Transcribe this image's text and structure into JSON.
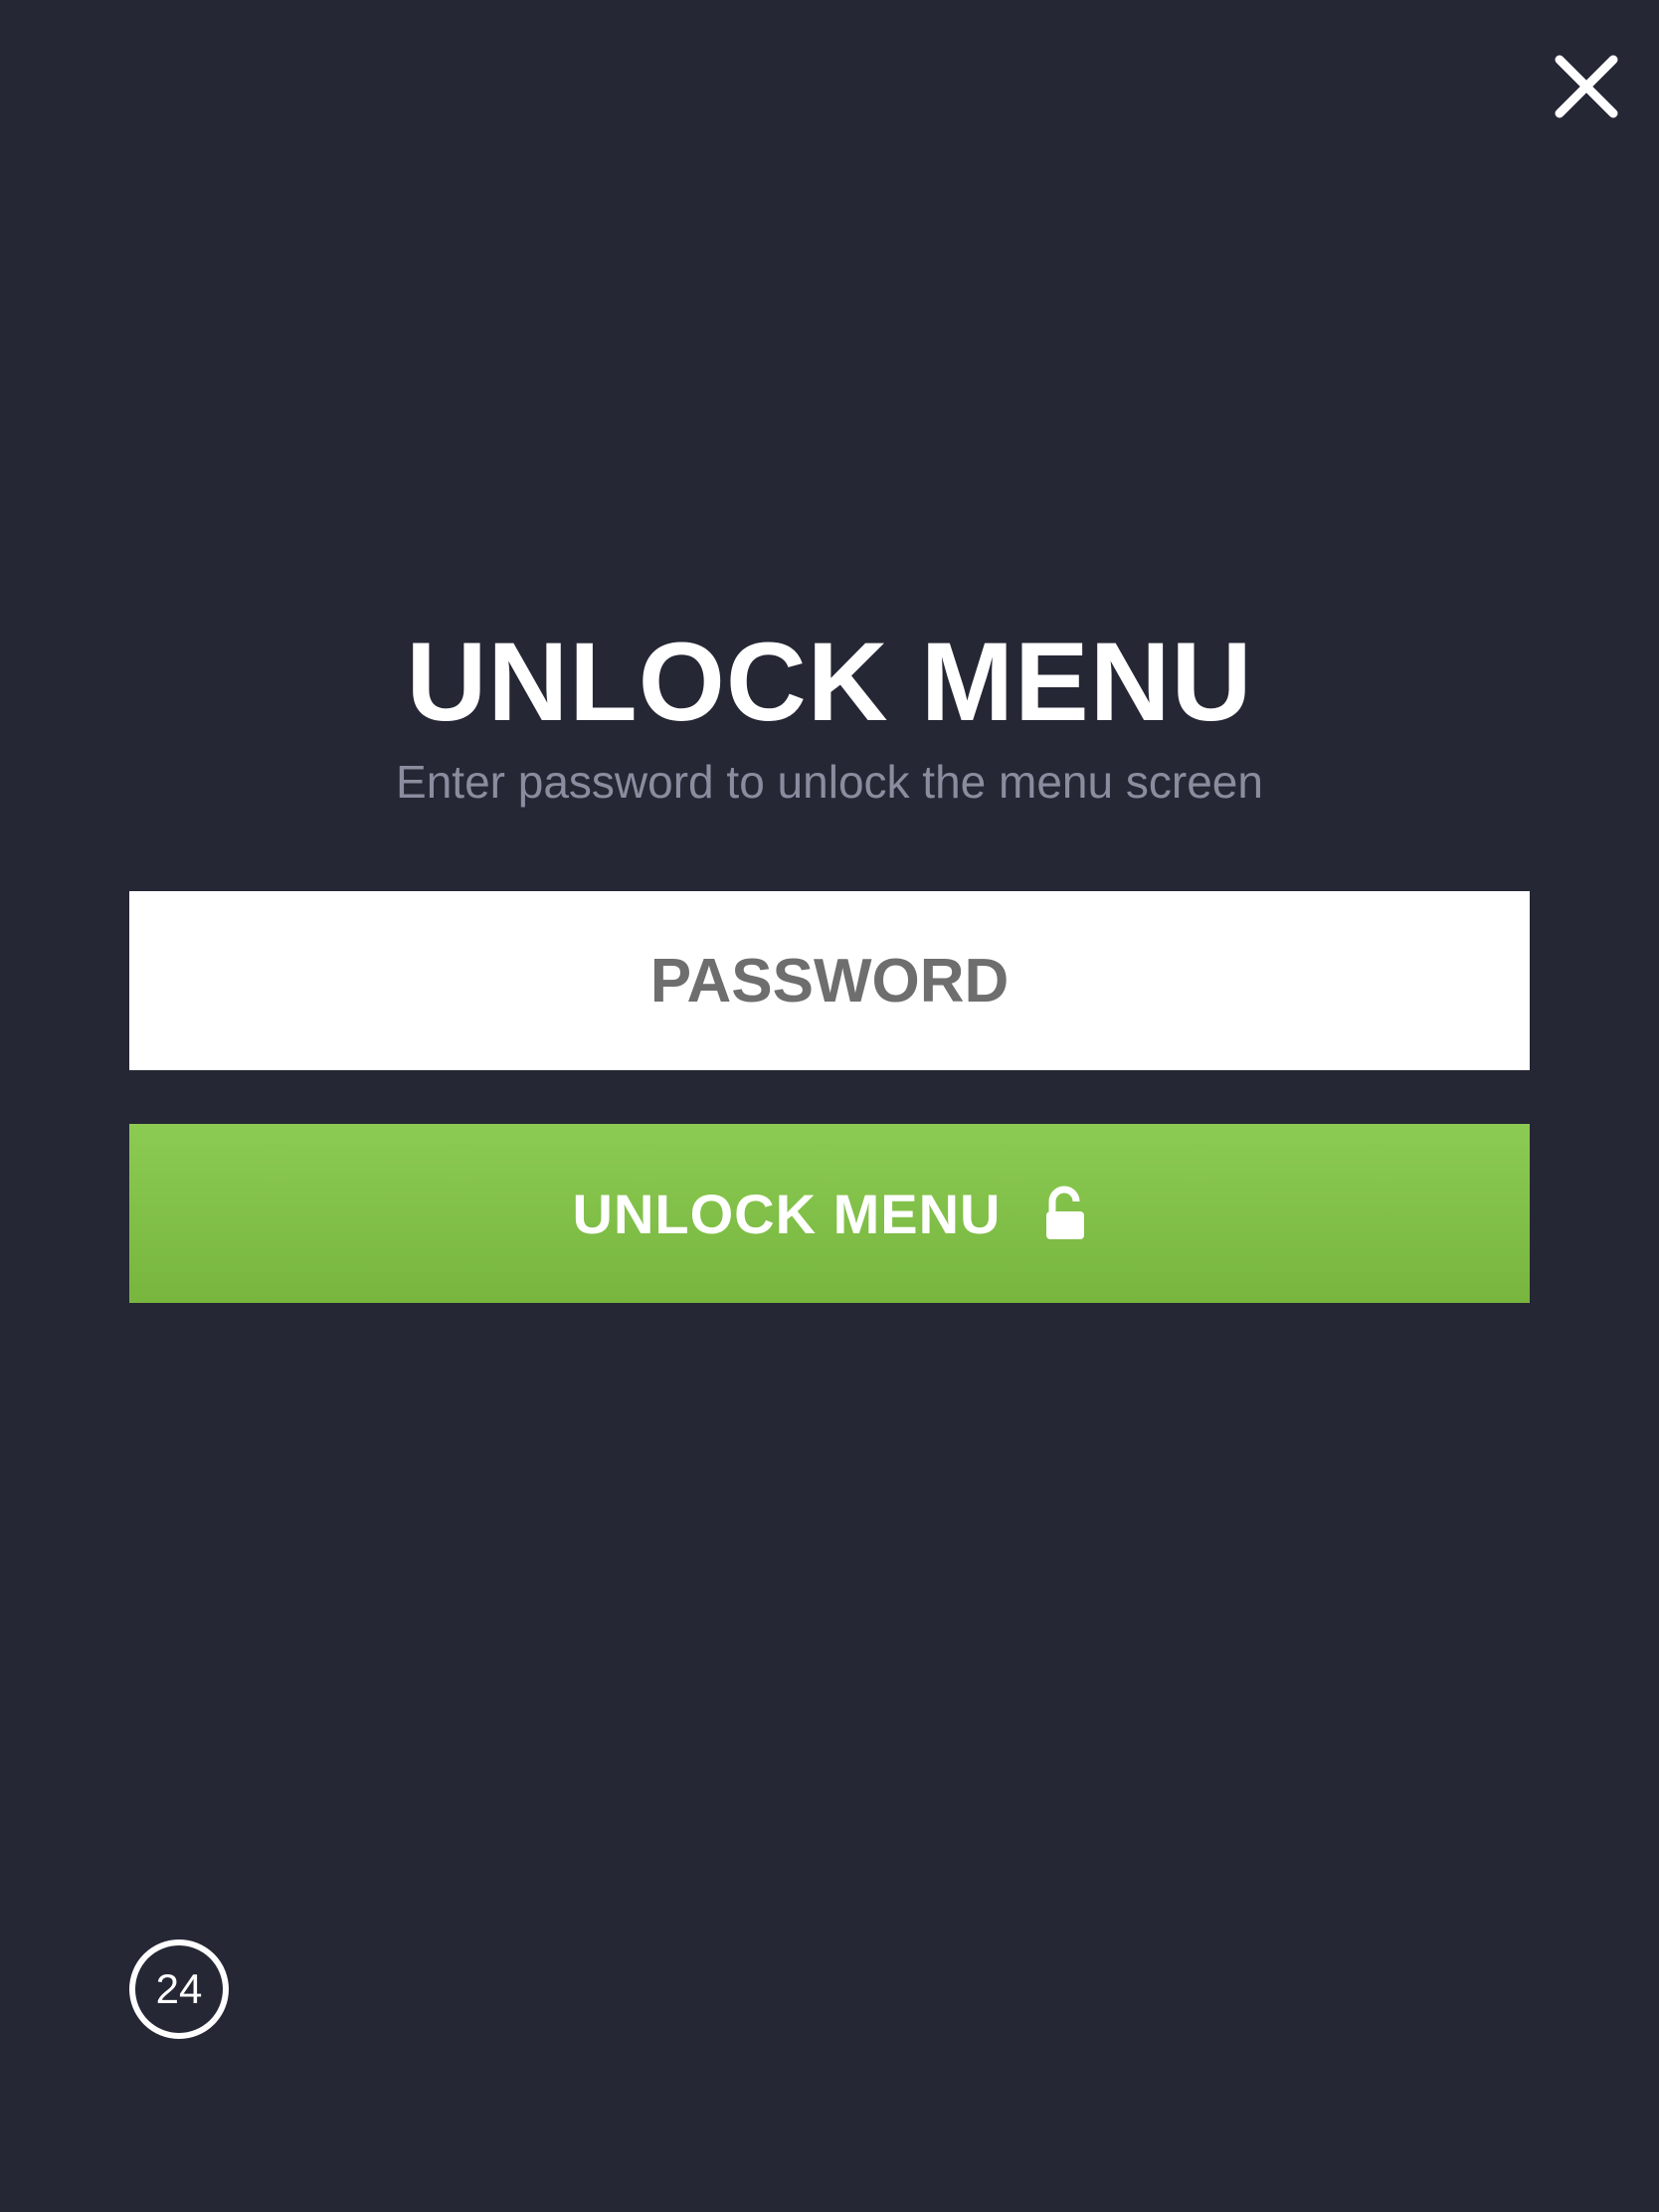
{
  "close": {
    "icon": "close-icon"
  },
  "header": {
    "title": "UNLOCK MENU",
    "subtitle": "Enter password to unlock the menu screen"
  },
  "password": {
    "placeholder": "PASSWORD",
    "value": ""
  },
  "unlock_button": {
    "label": "UNLOCK MENU",
    "icon": "unlock-icon"
  },
  "countdown": {
    "value": "24"
  },
  "colors": {
    "background": "#252735",
    "accent_green": "#82c049",
    "subtitle_gray": "#8b8d9f",
    "placeholder_gray": "#6e6e6e"
  }
}
